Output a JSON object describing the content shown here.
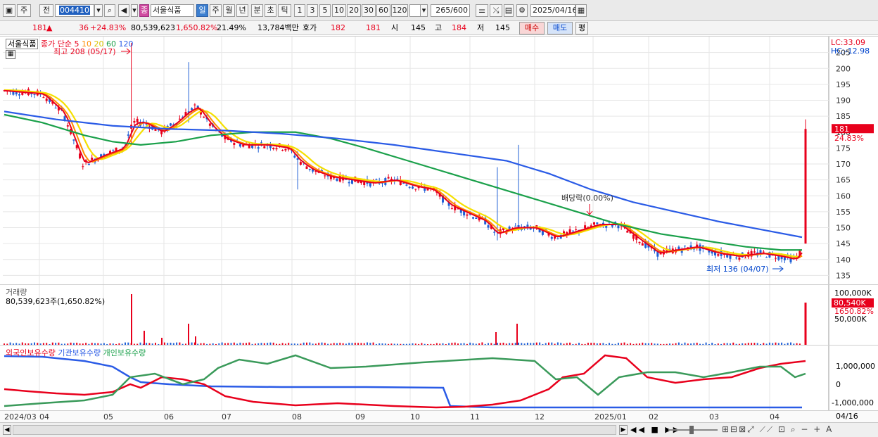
{
  "toolbar": {
    "period_label": "주",
    "prev_label": "전",
    "stock_code": "004410",
    "stock_name": "서울식품",
    "badge": "종",
    "period_tabs": [
      "일",
      "주",
      "월",
      "년",
      "분",
      "초",
      "틱"
    ],
    "active_tab": "일",
    "intervals": [
      "1",
      "3",
      "5",
      "10",
      "20",
      "30",
      "60",
      "120"
    ],
    "count": "265",
    "count_total": "/600",
    "date": "2025/04/16"
  },
  "quote": {
    "price": "181",
    "change": "36",
    "change_pct": "+24.83%",
    "volume": "80,539,623",
    "volume_pct": "1,650.82%",
    "turnover": "21.49%",
    "amount": "13,784백만",
    "bid_label": "호가",
    "bid1": "182",
    "bid2": "181",
    "open_label": "시",
    "open": "145",
    "high_label": "고",
    "high": "184",
    "low_label": "저",
    "low": "145",
    "buy_label": "매수",
    "sell_label": "매도",
    "eval_label": "평"
  },
  "price_panel": {
    "title": "서울식품",
    "ma_label": "종가 단순",
    "ma_periods": [
      "5",
      "10",
      "20",
      "60",
      "120"
    ],
    "lc": "LC:33.09",
    "hc": "HC:-12.98",
    "high_note": "최고 208 (05/17)",
    "low_note": "최저 136 (04/07)",
    "div_note": "배당락(0.00%)",
    "last_price": "181",
    "last_pct": "24.83%",
    "y_ticks": [
      "205",
      "200",
      "195",
      "190",
      "185",
      "180",
      "175",
      "170",
      "165",
      "160",
      "155",
      "150",
      "145",
      "140",
      "135"
    ]
  },
  "volume_panel": {
    "title": "거래량",
    "value": "80,539,623주(1,650.82%)",
    "y_ticks": [
      "100,000K",
      "50,000K"
    ],
    "last_value": "80,540K",
    "last_pct": "1650.82%"
  },
  "holding_panel": {
    "labels": [
      "외국인보유수량",
      "기관보유수량",
      "개인보유수량"
    ],
    "y_ticks": [
      "1,000,000",
      "0",
      "-1,000,000"
    ]
  },
  "x_axis": {
    "labels": [
      "2024/03",
      "04",
      "05",
      "06",
      "07",
      "08",
      "09",
      "10",
      "11",
      "12",
      "2025/01",
      "02",
      "03",
      "04"
    ],
    "right_label": "04/16"
  },
  "colors": {
    "up": "#e8001c",
    "down": "#1f5fd6",
    "ma5": "#e8001c",
    "ma10": "#ff8c00",
    "ma20": "#f5e000",
    "ma60": "#1aa04a",
    "ma120": "#2a5be6"
  },
  "chart_data": [
    {
      "type": "line",
      "title": "서울식품",
      "series": [
        {
          "name": "120",
          "x": [
            "2024-03-01",
            "2024-05-15",
            "2024-07-15",
            "2024-09-01",
            "2024-11-01",
            "2025-01-01",
            "2025-03-01",
            "2025-04-16"
          ],
          "values": [
            186.5,
            182,
            180,
            177,
            172,
            160,
            151,
            147
          ]
        },
        {
          "name": "60",
          "x": [
            "2024-03-01",
            "2024-05-01",
            "2024-06-01",
            "2024-07-15",
            "2024-09-01",
            "2024-11-01",
            "2025-01-01",
            "2025-03-01",
            "2025-04-16"
          ],
          "values": [
            185.5,
            178,
            177,
            180,
            172,
            160,
            150,
            145,
            143
          ]
        }
      ],
      "ylim": [
        132,
        210
      ],
      "annotations": [
        "최고 208 (05/17)",
        "최저 136 (04/07)",
        "배당락(0.00%)"
      ]
    }
  ]
}
